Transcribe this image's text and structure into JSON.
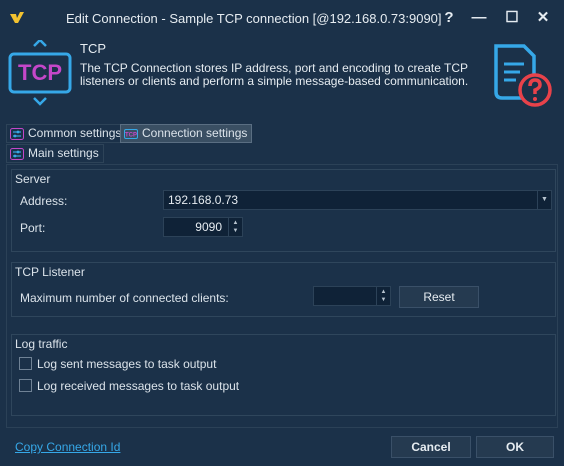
{
  "window": {
    "title": "Edit Connection - Sample TCP connection [@192.168.0.73:9090]",
    "help_label": "?",
    "minimize_label": "—",
    "maximize_label": "☐",
    "close_label": "✕"
  },
  "header": {
    "logo_text": "TCP",
    "title": "TCP",
    "description": "The TCP Connection stores IP address, port and encoding to create TCP listeners or clients and perform a simple message-based communication."
  },
  "tabs": {
    "row1": [
      {
        "label": "Common settings",
        "icon": "settings-sliders-icon"
      },
      {
        "label": "Connection settings",
        "icon": "tcp-icon"
      }
    ],
    "row2": [
      {
        "label": "Main settings",
        "icon": "settings-sliders-icon"
      }
    ]
  },
  "server": {
    "title": "Server",
    "address_label": "Address:",
    "address_value": "192.168.0.73",
    "port_label": "Port:",
    "port_value": "9090"
  },
  "listener": {
    "title": "TCP Listener",
    "max_clients_label": "Maximum number of connected clients:",
    "max_clients_value": "",
    "reset_label": "Reset"
  },
  "log": {
    "title": "Log traffic",
    "sent_label": "Log sent messages to task output",
    "sent_checked": false,
    "received_label": "Log received messages to task output",
    "received_checked": false
  },
  "footer": {
    "copy_link": "Copy Connection Id",
    "cancel_label": "Cancel",
    "ok_label": "OK"
  },
  "colors": {
    "background": "#1b3149",
    "accent_purple": "#c447c9",
    "icon_blue": "#36a8e8",
    "icon_red": "#e8424a",
    "link": "#36a8e8"
  }
}
